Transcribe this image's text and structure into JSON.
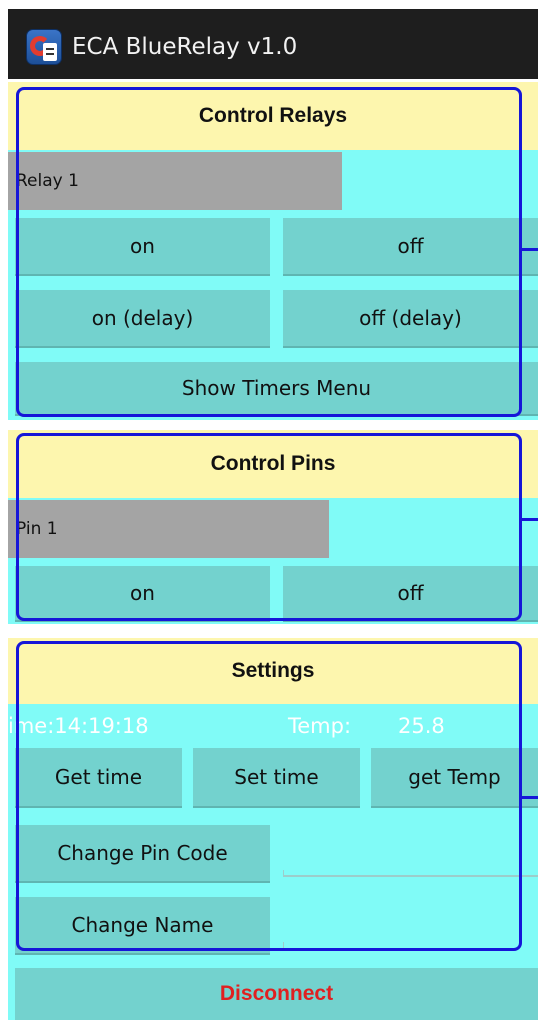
{
  "app": {
    "title": "ECA BlueRelay v1.0",
    "icon": "eca-app-icon"
  },
  "relays": {
    "header": "Control Relays",
    "selector_value": "Relay 1",
    "buttons": {
      "on": "on",
      "off": "off",
      "on_delay": "on (delay)",
      "off_delay": "off (delay)",
      "timers": "Show Timers Menu"
    }
  },
  "pins": {
    "header": "Control Pins",
    "selector_value": "Pin 1",
    "buttons": {
      "on": "on",
      "off": "off"
    }
  },
  "settings": {
    "header": "Settings",
    "time_readout": "ime:14:19:18",
    "temp_label": "Temp:",
    "temp_value": "25.8",
    "buttons": {
      "get_time": "Get time",
      "set_time": "Set time",
      "get_temp": "get Temp",
      "change_pin": "Change Pin Code",
      "change_name": "Change Name"
    }
  },
  "disconnect": "Disconnect",
  "colors": {
    "background": "#80fbf7",
    "header": "#fdf6ae",
    "button": "#73d2ce",
    "frame": "#1616d8",
    "disconnect_text": "#e02020",
    "titlebar": "#1e1e1e"
  }
}
